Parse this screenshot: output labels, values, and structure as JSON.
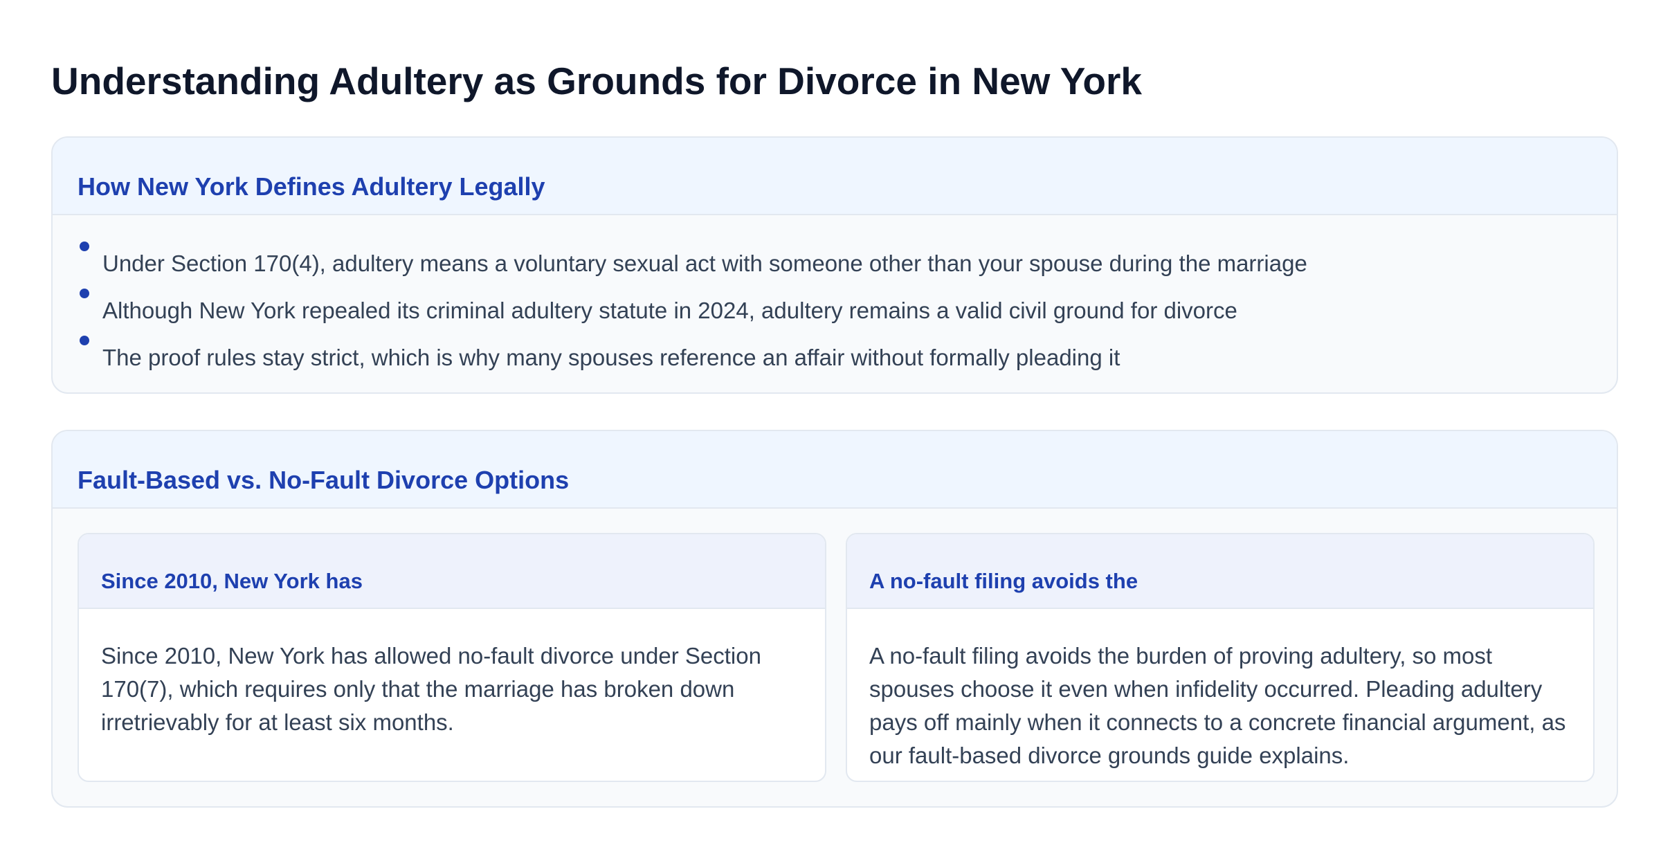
{
  "page": {
    "title": "Understanding Adultery as Grounds for Divorce in New York"
  },
  "definition_section": {
    "heading": "How New York Defines Adultery Legally",
    "bullets": [
      "Under Section 170(4), adultery means a voluntary sexual act with someone other than your spouse during the marriage",
      "Although New York repealed its criminal adultery statute in 2024, adultery remains a valid civil ground for divorce",
      "The proof rules stay strict, which is why many spouses reference an affair without formally pleading it"
    ]
  },
  "options_section": {
    "heading": "Fault-Based vs. No-Fault Divorce Options",
    "cards": [
      {
        "title": "Since 2010, New York has",
        "body": "Since 2010, New York has allowed no-fault divorce under Section 170(7), which requires only that the marriage has broken down irretrievably for at least six months."
      },
      {
        "title": "A no-fault filing avoids the",
        "body": "A no-fault filing avoids the burden of proving adultery, so most spouses choose it even when infidelity occurred. Pleading adultery pays off mainly when it connects to a concrete financial argument, as our fault-based divorce grounds guide explains."
      }
    ]
  },
  "theme": {
    "title_color": "#0f172a",
    "accent_color": "#1e40af",
    "text_color": "#334155",
    "card_background": "#f8fafc",
    "header_background": "#eff6ff",
    "border_color": "#e2e8f0"
  }
}
